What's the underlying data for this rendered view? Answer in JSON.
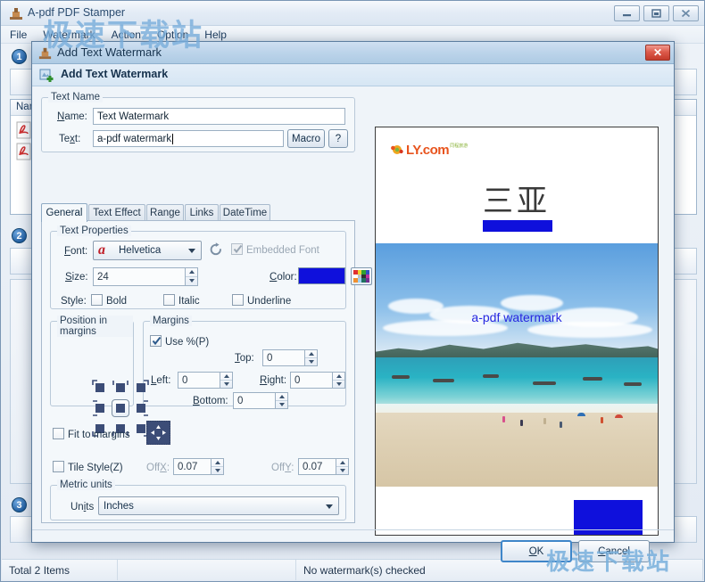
{
  "app": {
    "title": "A-pdf PDF Stamper",
    "title_icon": "stamp-icon",
    "menus": [
      "File",
      "Watermark",
      "Action",
      "Option",
      "Help"
    ],
    "window_buttons": {
      "minimize": "minimize-icon",
      "maximize": "maximize-icon",
      "close": "close-icon"
    },
    "list_header": "Name",
    "steps": [
      "1",
      "2",
      "3"
    ],
    "statusbar": {
      "total_items": "Total 2 Items",
      "middle": "",
      "watermark_status": "No watermark(s) checked"
    }
  },
  "dialog": {
    "titlebar": {
      "title": "Add Text Watermark",
      "icon": "stamp-icon",
      "close_label": "✕"
    },
    "header": {
      "title": "Add Text Watermark",
      "icon": "add-watermark-icon"
    },
    "text_name": {
      "group_label": "Text Name",
      "name_label": "Name:",
      "name_value": "Text Watermark",
      "text_label": "Text:",
      "text_value": "a-pdf watermark",
      "macro_button": "Macro",
      "help_button": "?"
    },
    "tabs": [
      {
        "label": "General",
        "active": true
      },
      {
        "label": "Text Effect",
        "active": false
      },
      {
        "label": "Range",
        "active": false
      },
      {
        "label": "Links",
        "active": false
      },
      {
        "label": "DateTime",
        "active": false
      }
    ],
    "text_properties": {
      "group_label": "Text Properties",
      "font_label": "Font:",
      "font_value": "Helvetica",
      "font_icon": "font-a-icon",
      "refresh_icon": "refresh-icon",
      "embedded_font_label": "Embedded Font",
      "embedded_font_checked": true,
      "embedded_font_enabled": false,
      "size_label": "Size:",
      "size_value": "24",
      "color_label": "Color:",
      "color_value": "#0f10dc",
      "palette_icon": "color-palette-icon",
      "style_label": "Style:",
      "bold_label": "Bold",
      "bold_checked": false,
      "italic_label": "Italic",
      "italic_checked": false,
      "underline_label": "Underline",
      "underline_checked": false
    },
    "position": {
      "group_label": "Position in margins",
      "selected_cell": 4,
      "cells": [
        "top-left",
        "top-center",
        "top-right",
        "middle-left",
        "middle-center",
        "middle-right",
        "bottom-left",
        "bottom-center",
        "bottom-right"
      ]
    },
    "margins": {
      "group_label": "Margins",
      "use_percent_label": "Use %(P)",
      "use_percent_checked": true,
      "top_label": "Top:",
      "top_value": "0",
      "left_label": "Left:",
      "left_value": "0",
      "right_label": "Right:",
      "right_value": "0",
      "bottom_label": "Bottom:",
      "bottom_value": "0"
    },
    "fit": {
      "fit_label": "Fit to margins",
      "fit_checked": false,
      "move_icon": "four-direction-arrows-icon",
      "tile_label": "Tile Style(Z)",
      "tile_checked": false,
      "offx_label": "OffX:",
      "offx_value": "0.07",
      "offy_label": "OffY:",
      "offy_value": "0.07"
    },
    "metric": {
      "group_label": "Metric units",
      "units_label": "Units",
      "units_value": "Inches"
    },
    "preview": {
      "logo_text": "LY.com",
      "logo_sub": "同程旅游",
      "heading_cn": "三亚",
      "watermark_text": "a-pdf watermark",
      "watermark_color": "#2626e0",
      "bar_color": "#0f10dc"
    },
    "footer": {
      "ok_label": "OK",
      "cancel_label": "Cancel"
    }
  },
  "watermarks": {
    "site_top": "极速下载站",
    "site_bottom": "极速下载站"
  }
}
